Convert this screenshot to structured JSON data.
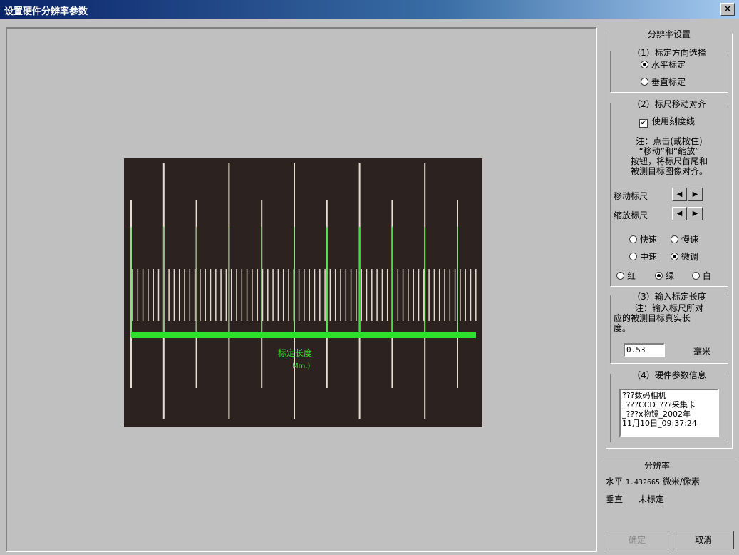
{
  "window": {
    "title": "设置硬件分辨率参数",
    "close_glyph": "×"
  },
  "image": {
    "label_main": "标定长度",
    "label_sub": "Mm.)",
    "colors": {
      "background": "#2c2220",
      "ruler": "#2ee02e",
      "ticks": "#e8dcd0"
    }
  },
  "settings": {
    "title": "分辨率设置",
    "section1": {
      "title": "（1）标定方向选择",
      "horizontal": "水平标定",
      "vertical": "垂直标定",
      "selected": "horizontal"
    },
    "section2": {
      "title": "（2）标尺移动对齐",
      "use_scale": "使用刻度线",
      "use_scale_checked": "true",
      "check_glyph": "✔",
      "note_lines": [
        "注：点击(或按住)",
        "“移动”和“缩放”",
        "按钮，将标尺首尾和",
        "被测目标图像对齐。"
      ],
      "move_label": "移动标尺",
      "zoom_label": "缩放标尺",
      "left_glyph": "◀",
      "right_glyph": "▶",
      "speed": {
        "fast": "快速",
        "slow": "慢速",
        "medium": "中速",
        "fine": "微调",
        "selected": "fine"
      },
      "color": {
        "red": "红",
        "green": "绿",
        "white": "白",
        "selected": "green"
      }
    },
    "section3": {
      "title": "（3）输入标定长度",
      "note_lines": [
        "注：输入标尺所对",
        "应的被测目标真实长",
        "度。"
      ],
      "value": "0.53",
      "unit": "毫米"
    },
    "section4": {
      "title": "（4）硬件参数信息",
      "info_lines": [
        "???数码相机",
        "_???CCD_???采集卡",
        "_???x物镜_2002年",
        "11月10日_09:37:24"
      ]
    }
  },
  "resolution": {
    "title": "分辨率",
    "horizontal_label": "水平",
    "horizontal_value": "1.432665",
    "horizontal_unit": "微米/像素",
    "vertical_label": "垂直",
    "vertical_value": "未标定"
  },
  "buttons": {
    "ok": "确定",
    "cancel": "取消"
  }
}
